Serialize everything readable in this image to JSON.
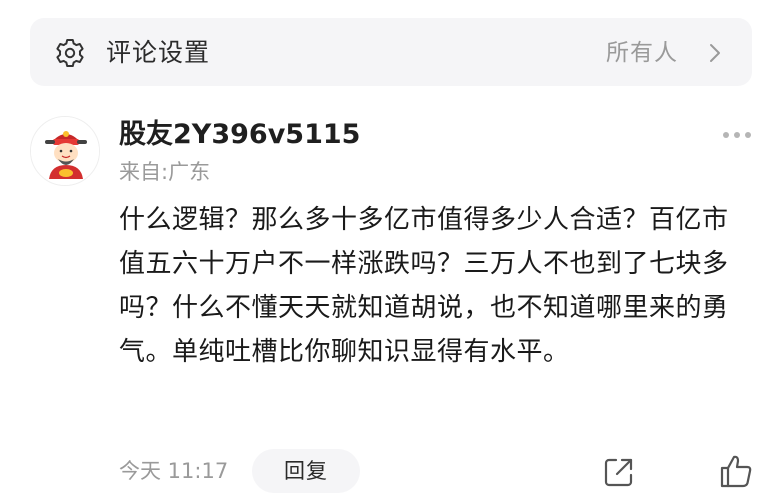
{
  "settings": {
    "icon": "gear-icon",
    "label": "评论设置",
    "value": "所有人",
    "chevron": "chevron-right-icon"
  },
  "comment": {
    "avatar": "avatar-caishen",
    "username": "股友2Y396v5115",
    "location": "来自:广东",
    "text": "什么逻辑？那么多十多亿市值得多少人合适？百亿市值五六十万户不一样涨跌吗？三万人不也到了七块多吗？什么不懂天天就知道胡说，也不知道哪里来的勇气。单纯吐槽比你聊知识显得有水平。",
    "time": "今天 11:17",
    "reply_label": "回复",
    "icons": {
      "more": "more-dots-icon",
      "share": "share-icon",
      "like": "thumbs-up-icon"
    }
  }
}
